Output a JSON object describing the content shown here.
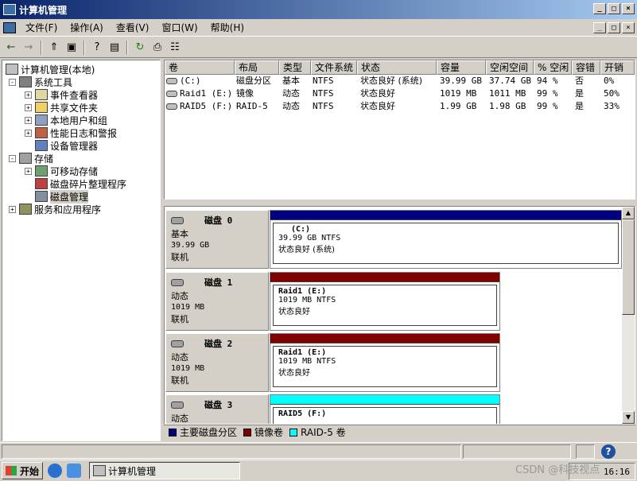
{
  "window": {
    "title": "计算机管理",
    "min": "_",
    "max": "□",
    "close": "×"
  },
  "menu": [
    "文件(F)",
    "操作(A)",
    "查看(V)",
    "窗口(W)",
    "帮助(H)"
  ],
  "toolbar": {
    "back": "←",
    "forward": "→",
    "up": "⇑",
    "tree": "▣",
    "properties": "?",
    "show": "▤",
    "refresh": "↻",
    "export": "⎙",
    "help": "☷"
  },
  "tree": {
    "root": "计算机管理(本地)",
    "system_tools": "系统工具",
    "event_viewer": "事件查看器",
    "shared_folders": "共享文件夹",
    "local_users": "本地用户和组",
    "perf_logs": "性能日志和警报",
    "device_manager": "设备管理器",
    "storage": "存储",
    "removable": "可移动存储",
    "defrag": "磁盘碎片整理程序",
    "disk_mgmt": "磁盘管理",
    "services": "服务和应用程序",
    "plus": "+",
    "minus": "-"
  },
  "volumes": {
    "headers": [
      "卷",
      "布局",
      "类型",
      "文件系统",
      "状态",
      "容量",
      "空闲空间",
      "% 空闲",
      "容错",
      "开销"
    ],
    "rows": [
      [
        "(C:)",
        "磁盘分区",
        "基本",
        "NTFS",
        "状态良好 (系统)",
        "39.99 GB",
        "37.74 GB",
        "94 %",
        "否",
        "0%"
      ],
      [
        "Raid1 (E:)",
        "镜像",
        "动态",
        "NTFS",
        "状态良好",
        "1019 MB",
        "1011 MB",
        "99 %",
        "是",
        "50%"
      ],
      [
        "RAID5 (F:)",
        "RAID-5",
        "动态",
        "NTFS",
        "状态良好",
        "1.99 GB",
        "1.98 GB",
        "99 %",
        "是",
        "33%"
      ]
    ]
  },
  "disks": [
    {
      "name": "磁盘 0",
      "type": "基本",
      "size": "39.99 GB",
      "state": "联机",
      "part": {
        "name": "(C:)",
        "fs": "39.99 GB NTFS",
        "status": "状态良好 (系统)",
        "color": "#000080"
      }
    },
    {
      "name": "磁盘 1",
      "type": "动态",
      "size": "1019 MB",
      "state": "联机",
      "part": {
        "name": "Raid1 (E:)",
        "fs": "1019 MB NTFS",
        "status": "状态良好",
        "color": "#800000"
      }
    },
    {
      "name": "磁盘 2",
      "type": "动态",
      "size": "1019 MB",
      "state": "联机",
      "part": {
        "name": "Raid1 (E:)",
        "fs": "1019 MB NTFS",
        "status": "状态良好",
        "color": "#800000"
      }
    },
    {
      "name": "磁盘 3",
      "type": "动态",
      "size": "",
      "state": "",
      "part": {
        "name": "RAID5 (F:)",
        "fs": "",
        "status": "",
        "color": "#00ffff"
      }
    }
  ],
  "legend": [
    {
      "label": "主要磁盘分区",
      "color": "#000080"
    },
    {
      "label": "镜像卷",
      "color": "#800000"
    },
    {
      "label": "RAID-5 卷",
      "color": "#00ffff"
    }
  ],
  "taskbar": {
    "start": "开始",
    "task": "计算机管理",
    "time": "16:16"
  },
  "watermark": "CSDN @科技视点"
}
